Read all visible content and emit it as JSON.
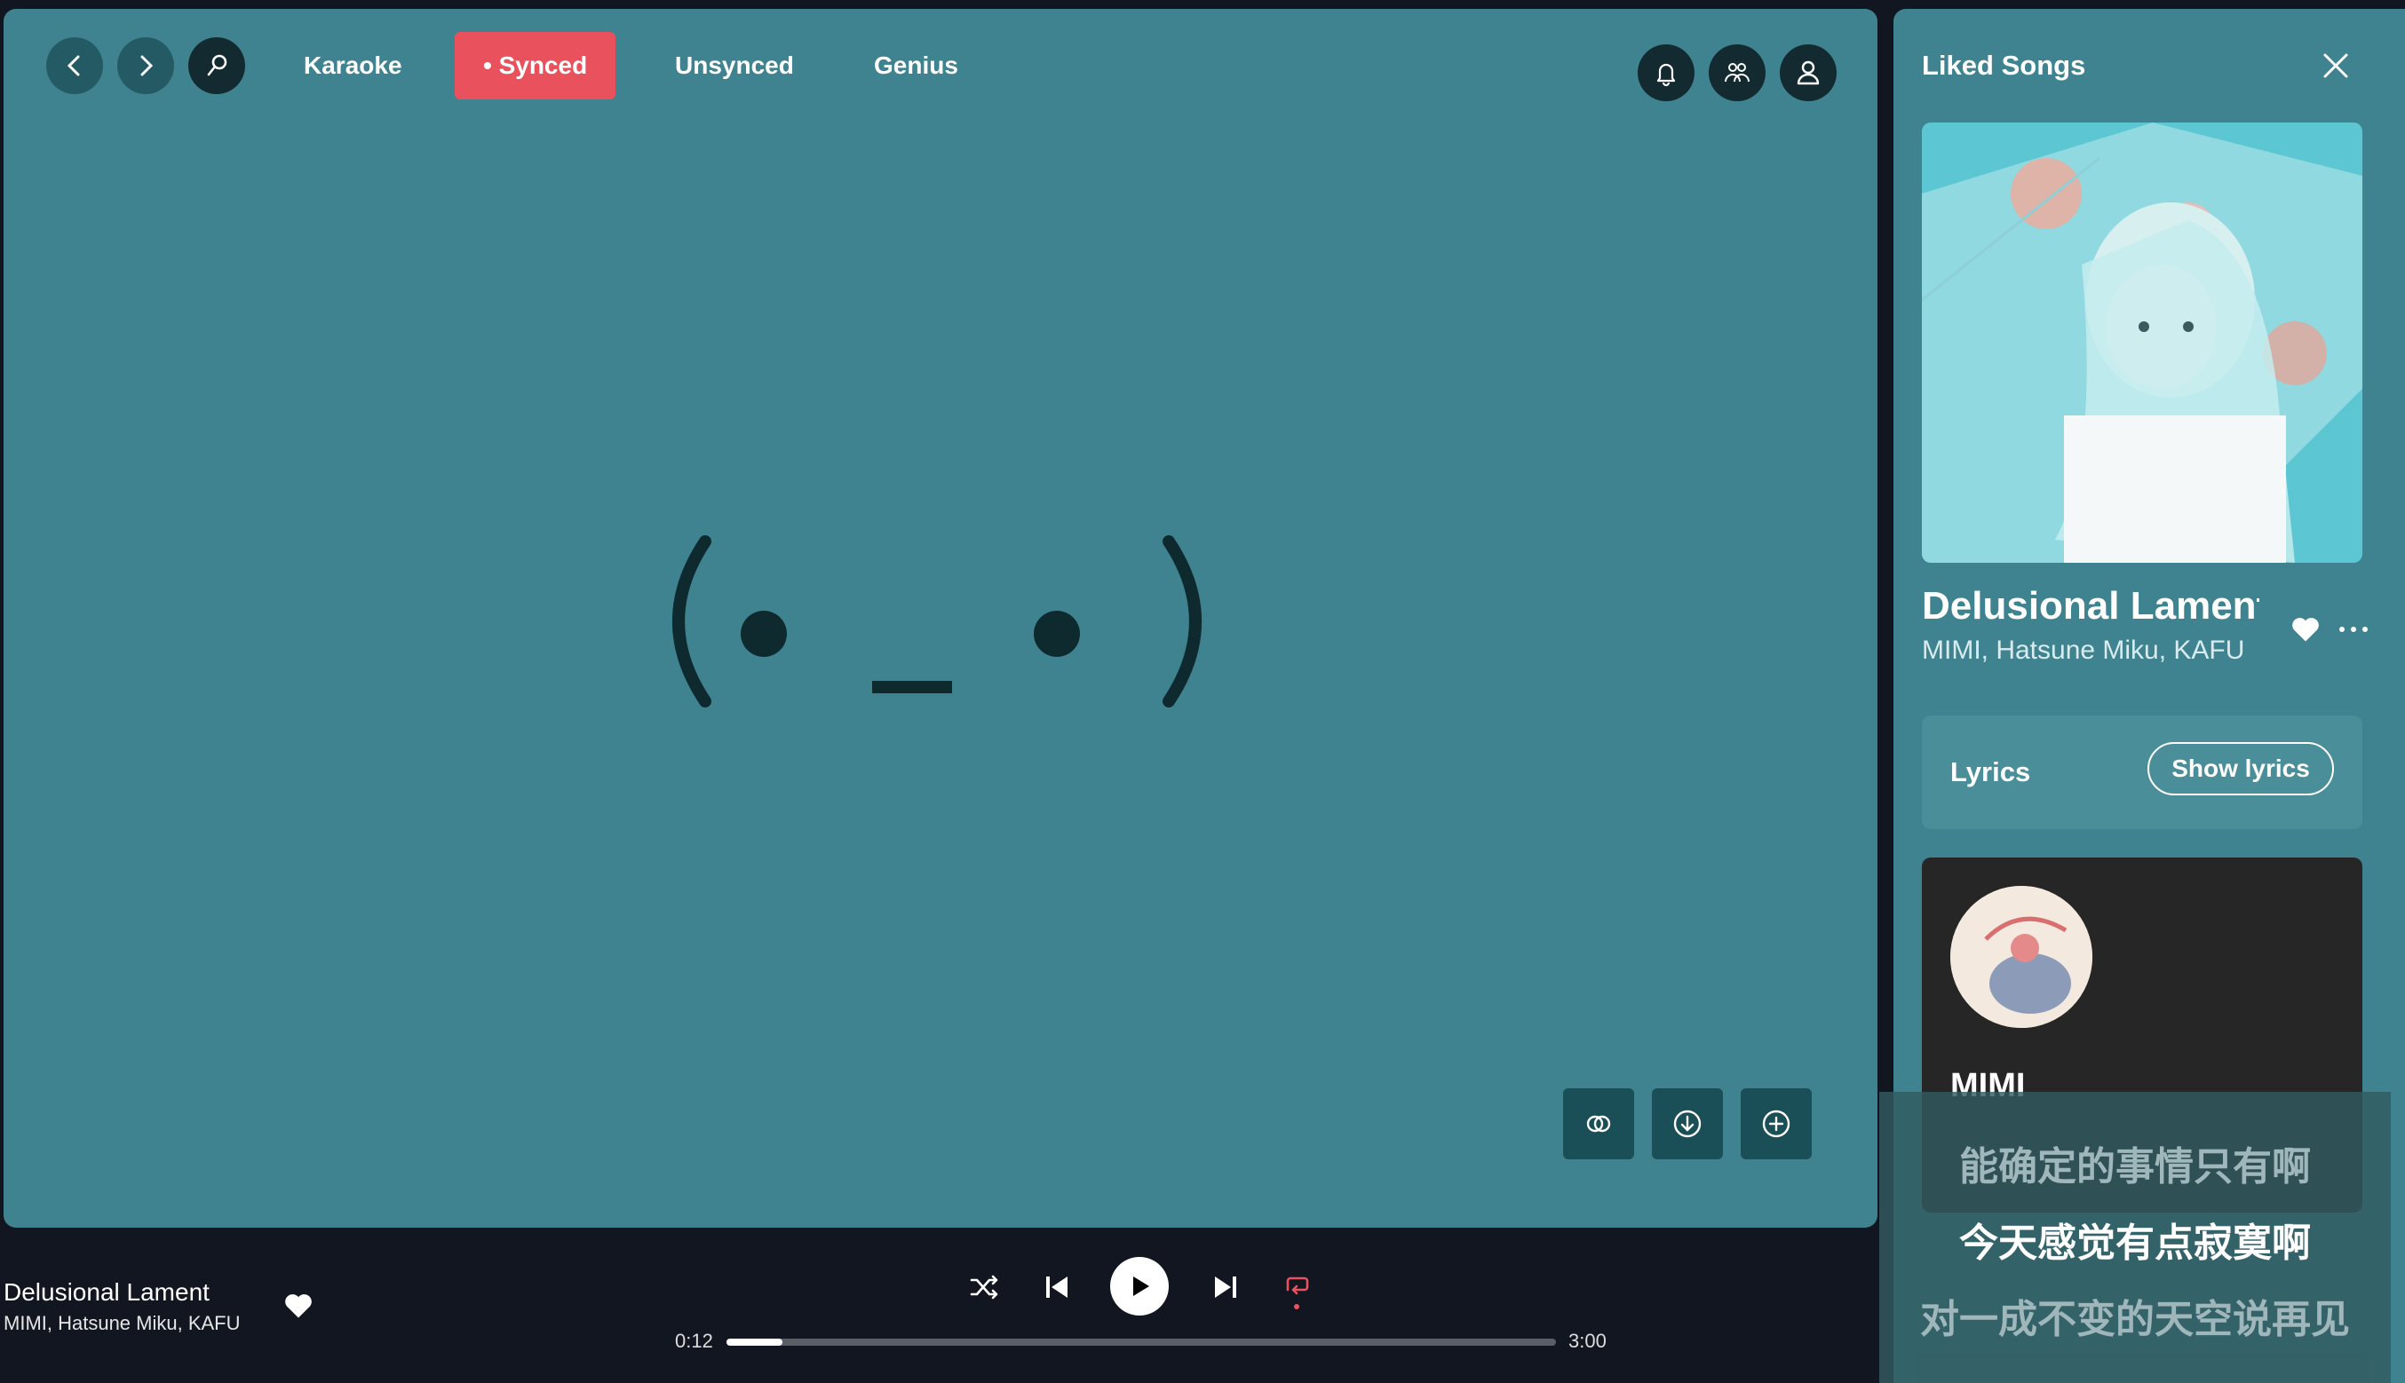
{
  "nav": {
    "tabs": [
      {
        "label": "Karaoke"
      },
      {
        "label": "• Synced"
      },
      {
        "label": "Unsynced"
      },
      {
        "label": "Genius"
      }
    ]
  },
  "main": {
    "face_left": "(",
    "face_right": ")",
    "icons": [
      "back-icon",
      "forward-icon",
      "search-icon",
      "bell-icon",
      "friends-icon",
      "user-icon",
      "compare-icon",
      "download-icon",
      "add-icon"
    ]
  },
  "panel": {
    "title": "Liked Songs",
    "song_title": "Delusional Lament",
    "song_artists": "MIMI, Hatsune Miku, KAFU",
    "lyrics_label": "Lyrics",
    "show_lyrics_label": "Show lyrics",
    "artist_name": "MIMI"
  },
  "overlay": {
    "lines": [
      "能确定的事情只有啊",
      "今天感觉有点寂寞啊",
      "对一成不变的天空说再见"
    ]
  },
  "player": {
    "title": "Delusional Lament",
    "artists": "MIMI, Hatsune Miku, KAFU",
    "elapsed": "0:12",
    "duration": "3:00",
    "progress": 0.067,
    "repeat_active_color": "#e9515c"
  },
  "colors": {
    "accent": "#e9515c",
    "background": "#3e838f",
    "player_bg": "#121620"
  }
}
